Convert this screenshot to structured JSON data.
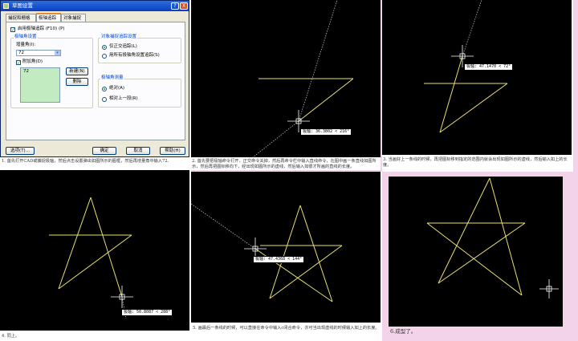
{
  "dialog": {
    "title": "草图设置",
    "help_btn": "?",
    "close_btn": "X",
    "tabs": [
      "捕捉和栅格",
      "极轴追踪",
      "对象捕捉"
    ],
    "enable_polar": "启用极轴追踪 (F10) (P)",
    "polar_angle_group": "极轴角设置",
    "increment_label": "增量角(I):",
    "increment_value": "72",
    "additional_label": "附加角(D)",
    "additional_items": [
      "72"
    ],
    "new_btn": "新建(N)",
    "delete_btn": "删除",
    "snap_group": "对象捕捉追踪设置",
    "snap_opt1": "仅正交追踪(L)",
    "snap_opt2": "用所有极轴角设置追踪(S)",
    "measure_group": "极轴角测量",
    "measure_opt1": "绝对(A)",
    "measure_opt2": "相对上一段(R)",
    "options_btn": "选项(T)...",
    "ok_btn": "确定",
    "cancel_btn": "取消",
    "help_btn2": "帮助(H)"
  },
  "tooltips": {
    "step2": "极轴: 36.3802 < 216°",
    "step3": "极轴: 47.1470 < 72°",
    "step4": "极轴: 50.8087 < 288°",
    "step5": "极轴: 47.4368 < 144°"
  },
  "captions": {
    "step1": "1. 首先打开CAD或捕捉极轴，然后点击设置弹出如图所示的图框，然后再增量角中输入72.",
    "step2": "2. 首先要把极轴命令打开，正交命令关掉，然后再命令栏中输入直线命令，在图中画一条直线如图所示，然后再把图标移向下，经出现如图所示的虚线，然后输入如很才所画的直线的长度。",
    "step3": "3. 当画好上一条线的时候，再把图标移到指定的范围内就会出现如图所示的虚线，然后输入如上的长度。",
    "step4": "4. 同上。",
    "step5": "5. 画最后一条线的时候，可以直接在命令中输入c闭合命令，亦可当出现虚线的时候输入如上的长度。",
    "step6": "6.成型了。"
  },
  "colors": {
    "drawing_line": "#e8e070",
    "background": "#000000",
    "page_bg": "#f3d3ea"
  }
}
